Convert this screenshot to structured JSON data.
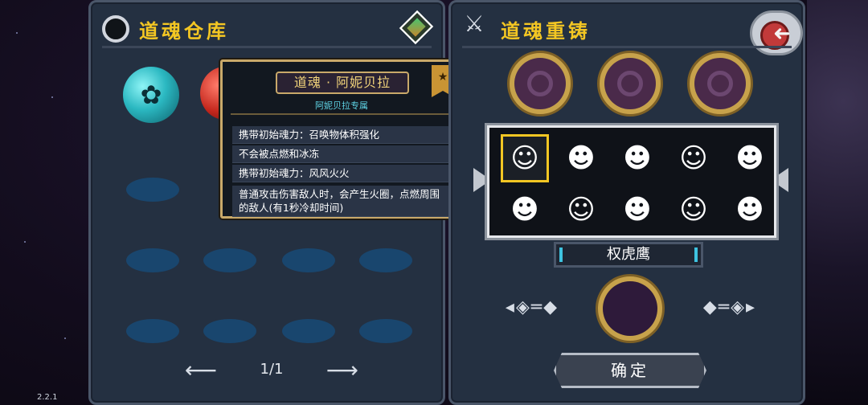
{
  "left_panel": {
    "title": "道魂仓库",
    "page_indicator": "1/1"
  },
  "tooltip": {
    "name": "道魂 · 阿妮贝拉",
    "subtitle": "阿妮贝拉专属",
    "lines": [
      "携带初始魂力：召唤物体积强化",
      "不会被点燃和冰冻",
      "携带初始魂力：风风火火",
      "普通攻击伤害敌人时，会产生火圈，点燃周围的敌人(有1秒冷却时间)"
    ]
  },
  "right_panel": {
    "title": "道魂重铸",
    "selected_name": "权虎鹰",
    "confirm_label": "确定"
  },
  "version": "2.2.1"
}
